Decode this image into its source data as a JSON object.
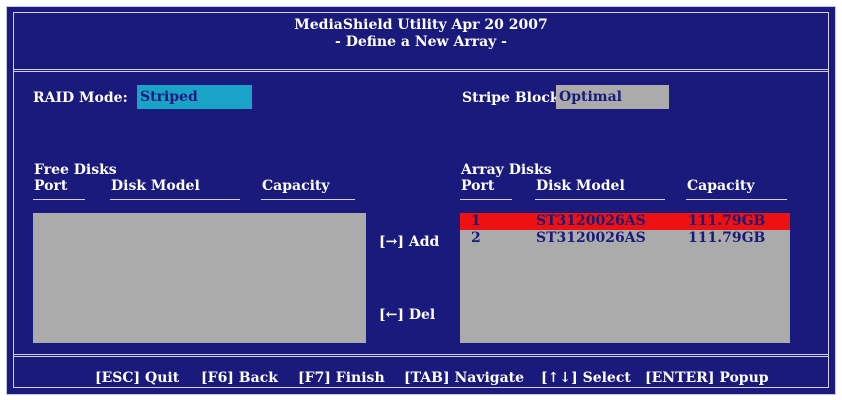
{
  "header": {
    "title_line1": "MediaShield Utility  Apr 20 2007",
    "title_line2": "- Define a New Array -"
  },
  "raid_mode": {
    "label": "RAID Mode:",
    "value": "Striped"
  },
  "stripe_block": {
    "label": "Stripe Block:",
    "value": "Optimal"
  },
  "free_disks": {
    "title": "Free Disks",
    "columns": {
      "port": "Port",
      "model": "Disk Model",
      "capacity": "Capacity"
    },
    "rows": []
  },
  "array_disks": {
    "title": "Array Disks",
    "columns": {
      "port": "Port",
      "model": "Disk Model",
      "capacity": "Capacity"
    },
    "rows": [
      {
        "port": "1",
        "model": "ST3120026AS",
        "capacity": "111.79GB",
        "selected": true
      },
      {
        "port": "2",
        "model": "ST3120026AS",
        "capacity": "111.79GB",
        "selected": false
      }
    ]
  },
  "actions": {
    "add": "[→] Add",
    "del": "[←] Del"
  },
  "footer": {
    "quit": "[ESC] Quit",
    "back": "[F6] Back",
    "finish": "[F7] Finish",
    "navigate": "[TAB] Navigate",
    "select": "[↑↓] Select",
    "popup": "[ENTER] Popup"
  },
  "colors": {
    "background": "#1a1a7c",
    "raid_field": "#1aa3c8",
    "stripe_field": "#ababab",
    "list_bg": "#ababab",
    "selected_row": "#ee1111"
  }
}
